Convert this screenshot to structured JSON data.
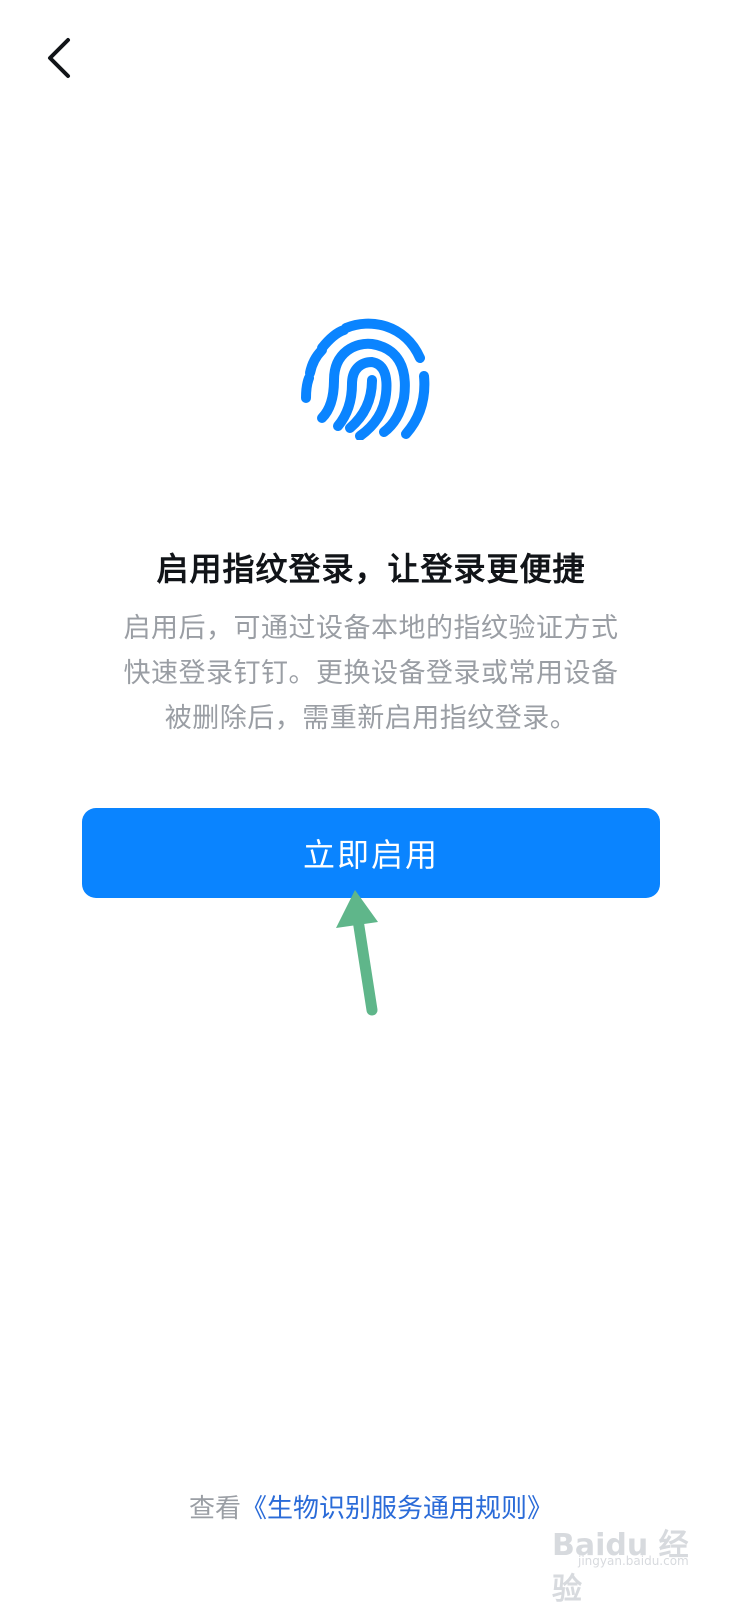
{
  "nav": {
    "back_icon": "chevron-left-icon"
  },
  "hero": {
    "icon": "fingerprint-icon",
    "accent_color": "#0a84ff"
  },
  "title": "启用指纹登录，让登录更便捷",
  "description_lines": [
    "启用后，可通过设备本地的指纹验证方式",
    "快速登录钉钉。更换设备登录或常用设备",
    "被删除后，需重新启用指纹登录。"
  ],
  "primary_button": {
    "label": "立即启用",
    "color": "#0a84ff"
  },
  "annotation": {
    "icon": "arrow-up-icon",
    "color": "#5fb68a"
  },
  "footer": {
    "prefix": "查看",
    "link_text": "《生物识别服务通用规则》"
  },
  "watermark": {
    "text": "Baidu 经验",
    "sub": "jingyan.baidu.com"
  }
}
